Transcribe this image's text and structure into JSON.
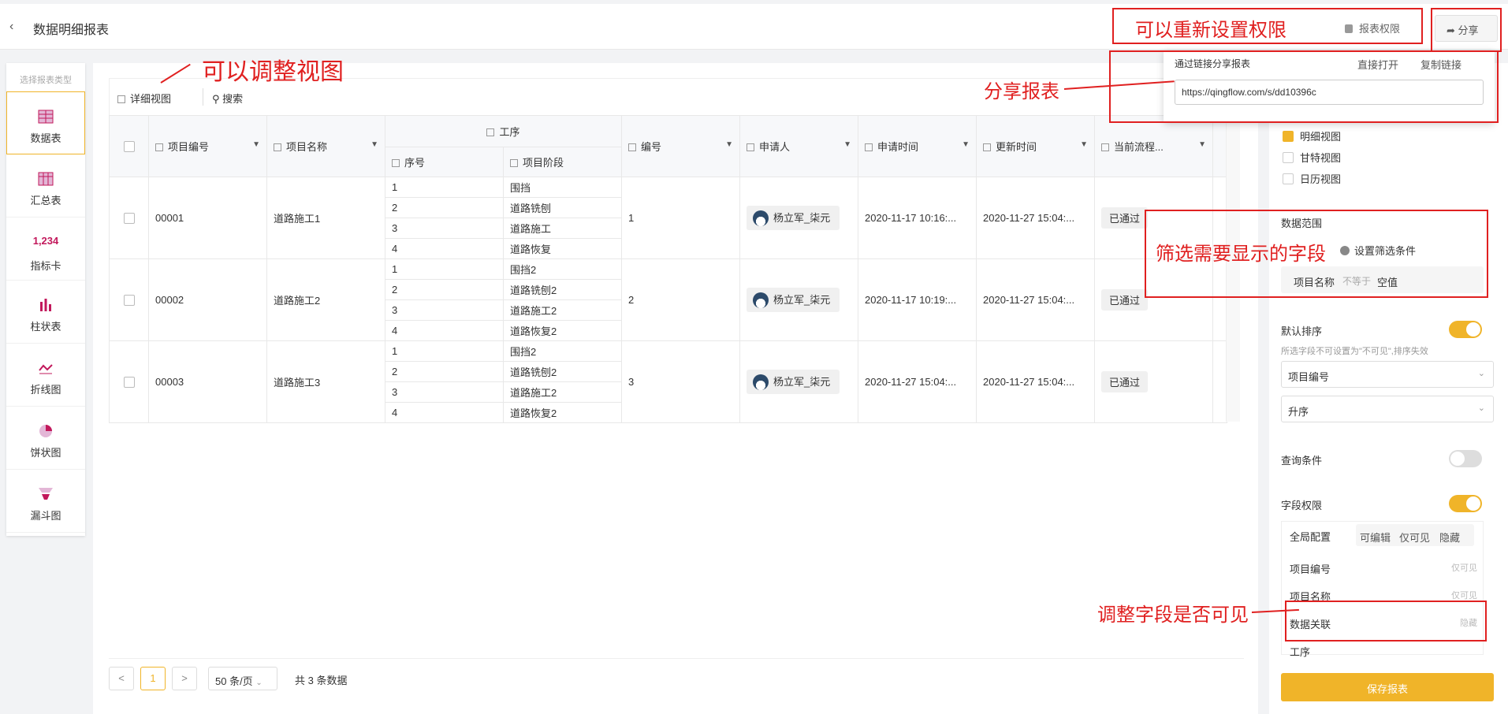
{
  "header": {
    "back_icon": "chevron-left-icon",
    "title": "数据明细报表",
    "permission_label": "报表权限",
    "share_label": "分享"
  },
  "annotations": {
    "reset_permission": "可以重新设置权限",
    "adjust_view": "可以调整视图",
    "share_report": "分享报表",
    "filter_fields": "筛选需要显示的字段",
    "field_visibility": "调整字段是否可见"
  },
  "sidebar": {
    "title": "选择报表类型",
    "items": [
      {
        "label": "数据表",
        "icon": "table-icon",
        "active": true
      },
      {
        "label": "汇总表",
        "icon": "summary-table-icon"
      },
      {
        "label": "指标卡",
        "icon": "number-card-icon",
        "number": "1,234"
      },
      {
        "label": "柱状表",
        "icon": "bar-chart-icon"
      },
      {
        "label": "折线图",
        "icon": "line-chart-icon"
      },
      {
        "label": "饼状图",
        "icon": "pie-chart-icon"
      },
      {
        "label": "漏斗图",
        "icon": "funnel-icon"
      }
    ]
  },
  "toolbar": {
    "view_label": "详细视图",
    "search_label": "搜索"
  },
  "table": {
    "group_header": "工序",
    "headers": {
      "project_no": "项目编号",
      "project_name": "项目名称",
      "seq": "序号",
      "stage": "项目阶段",
      "code": "编号",
      "applicant": "申请人",
      "apply_time": "申请时间",
      "update_time": "更新时间",
      "flow": "当前流程..."
    },
    "rows": [
      {
        "project_no": "00001",
        "project_name": "道路施工1",
        "code": "1",
        "applicant": "杨立军_柒元",
        "apply_time": "2020-11-17 10:16:...",
        "update_time": "2020-11-27 15:04:...",
        "flow": "已通过",
        "sub": [
          {
            "seq": "1",
            "stage": "围挡"
          },
          {
            "seq": "2",
            "stage": "道路铣刨"
          },
          {
            "seq": "3",
            "stage": "道路施工"
          },
          {
            "seq": "4",
            "stage": "道路恢复"
          }
        ]
      },
      {
        "project_no": "00002",
        "project_name": "道路施工2",
        "code": "2",
        "applicant": "杨立军_柒元",
        "apply_time": "2020-11-17 10:19:...",
        "update_time": "2020-11-27 15:04:...",
        "flow": "已通过",
        "sub": [
          {
            "seq": "1",
            "stage": "围挡2"
          },
          {
            "seq": "2",
            "stage": "道路铣刨2"
          },
          {
            "seq": "3",
            "stage": "道路施工2"
          },
          {
            "seq": "4",
            "stage": "道路恢复2"
          }
        ]
      },
      {
        "project_no": "00003",
        "project_name": "道路施工3",
        "code": "3",
        "applicant": "杨立军_柒元",
        "apply_time": "2020-11-27 15:04:...",
        "update_time": "2020-11-27 15:04:...",
        "flow": "已通过",
        "sub": [
          {
            "seq": "1",
            "stage": "围挡2"
          },
          {
            "seq": "2",
            "stage": "道路铣刨2"
          },
          {
            "seq": "3",
            "stage": "道路施工2"
          },
          {
            "seq": "4",
            "stage": "道路恢复2"
          }
        ]
      }
    ]
  },
  "pager": {
    "prev": "<",
    "current": "1",
    "next": ">",
    "page_size": "50 条/页",
    "total": "共 3 条数据"
  },
  "share_popup": {
    "label": "通过链接分享报表",
    "open": "直接打开",
    "copy": "复制链接",
    "url": "https://qingflow.com/s/dd10396c"
  },
  "right_panel": {
    "views": [
      {
        "label": "明细视图",
        "checked": true
      },
      {
        "label": "甘特视图",
        "checked": false
      },
      {
        "label": "日历视图",
        "checked": false
      }
    ],
    "data_range": {
      "title": "数据范围",
      "add_filter": "设置筛选条件",
      "filter_field": "项目名称",
      "filter_op": "不等于",
      "filter_value": "空值"
    },
    "default_sort": {
      "title": "默认排序",
      "hint": "所选字段不可设置为\"不可见\",排序失效",
      "field": "项目编号",
      "order": "升序",
      "enabled": true
    },
    "query": {
      "title": "查询条件",
      "enabled": false
    },
    "field_perm": {
      "title": "字段权限",
      "enabled": true,
      "global": "全局配置",
      "options": [
        "可编辑",
        "仅可见",
        "隐藏"
      ],
      "fields": [
        {
          "name": "项目编号",
          "value": "仅可见"
        },
        {
          "name": "项目名称",
          "value": "仅可见"
        },
        {
          "name": "数据关联",
          "value": "隐藏"
        },
        {
          "name": "工序",
          "value": ""
        }
      ]
    },
    "save": "保存报表"
  },
  "colors": {
    "accent": "#f0b429",
    "annotation": "#e02020"
  }
}
